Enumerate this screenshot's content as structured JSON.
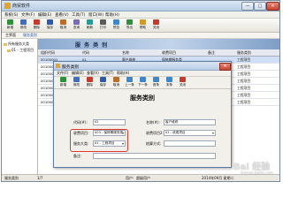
{
  "window": {
    "title": "商贸软件",
    "buttons": [
      "—",
      "□",
      "✕"
    ]
  },
  "menu": [
    "系统(S)",
    "文件(F)",
    "编辑(E)",
    "查看(V)",
    "工具(T)",
    "窗口(W)",
    "帮助(H)"
  ],
  "toolbar": [
    {
      "label": "新增",
      "icon": "new-icon",
      "color": "#2f8f3c"
    },
    {
      "label": "修改",
      "icon": "edit-icon",
      "color": "#3c6fc2"
    },
    {
      "label": "删除",
      "icon": "delete-icon",
      "color": "#c43b2e"
    },
    {
      "label": "保存",
      "icon": "save-icon",
      "color": "#2d5aa8"
    },
    {
      "label": "取消",
      "icon": "cancel-icon",
      "color": "#b86e2a"
    },
    {
      "label": "查询",
      "icon": "search-icon",
      "color": "#7a6bb8"
    },
    {
      "label": "刷新",
      "icon": "refresh-icon",
      "color": "#2a9a95"
    },
    {
      "label": "打印",
      "icon": "print-icon",
      "color": "#5a5a5a"
    },
    {
      "label": "预览",
      "icon": "preview-icon",
      "color": "#3e86c9"
    },
    {
      "label": "导出",
      "icon": "export-icon",
      "color": "#2f8f3c"
    },
    {
      "label": "帮助",
      "icon": "help-icon",
      "color": "#d09a2a"
    },
    {
      "label": "关闭",
      "icon": "close-icon",
      "color": "#c43b2e"
    }
  ],
  "subtoolbar": [
    "主界面",
    "服务类别"
  ],
  "tree": {
    "root": "所有服务大类",
    "child": "01  - 工程项目"
  },
  "main": {
    "banner_title": "服 务 类 别",
    "columns": [
      "组织代码",
      "代码",
      "名称",
      "收费项目",
      "备注",
      "服务类别"
    ],
    "rows": [
      {
        "c1": "00100001",
        "c2": "01",
        "c3": "客户维修",
        "c4": "保修期服务类",
        "c5": "",
        "c6": "工程项目"
      },
      {
        "c1": "00100002",
        "c2": "02",
        "c3": "",
        "c4": "保修期服务类",
        "c5": "",
        "c6": "工程项目"
      },
      {
        "c1": "00100003",
        "c2": "03",
        "c3": "",
        "c4": "",
        "c5": "",
        "c6": "工程项目"
      },
      {
        "c1": "00100004",
        "c2": "04",
        "c3": "",
        "c4": "",
        "c5": "",
        "c6": "工程项目"
      },
      {
        "c1": "00100005",
        "c2": "05",
        "c3": "",
        "c4": "",
        "c5": "",
        "c6": "工程项目"
      },
      {
        "c1": "00100006",
        "c2": "06",
        "c3": "",
        "c4": "",
        "c5": "",
        "c6": "工程项目"
      },
      {
        "c1": "00100007",
        "c2": "07",
        "c3": "",
        "c4": "",
        "c5": "",
        "c6": "工程项目"
      }
    ]
  },
  "dialog": {
    "title": "服务类别",
    "menu": [
      "文件(F)",
      "编辑(E)",
      "查看(V)",
      "工具(T)",
      "帮助(H)"
    ],
    "toolbar": [
      "新增",
      "修改",
      "删除",
      "保存",
      "取消",
      "上一条",
      "下一条",
      "首条",
      "末条",
      "关闭"
    ],
    "heading": "服务类别",
    "fields": {
      "code_label": "代码(#):",
      "code_value": "02",
      "name_label": "名称(#):",
      "name_value": "客户维修",
      "fee_label": "收费项目:",
      "fee_value": "003 - 保修期服务类",
      "fee2_label": "收费项目2:",
      "fee2_value": "01 - 收费项目",
      "service_label": "服务大类:",
      "service_value": "01 - 工程项目",
      "settle_label": "结算方式:",
      "settle_value": "",
      "note_label": "备注:",
      "note_value": ""
    }
  },
  "status": {
    "left": "服务类别",
    "middle": "1/7",
    "user_label": "用户:",
    "user_value": "超级用户",
    "right": "2014年09月 星期二"
  },
  "watermark": {
    "text": "Bai 经验",
    "sub": "jingyan.baidu.com"
  },
  "colors": {
    "accent": "#2d5aa8",
    "highlight_box": "#e03a2c",
    "selected_row": "#cfe0f6"
  }
}
